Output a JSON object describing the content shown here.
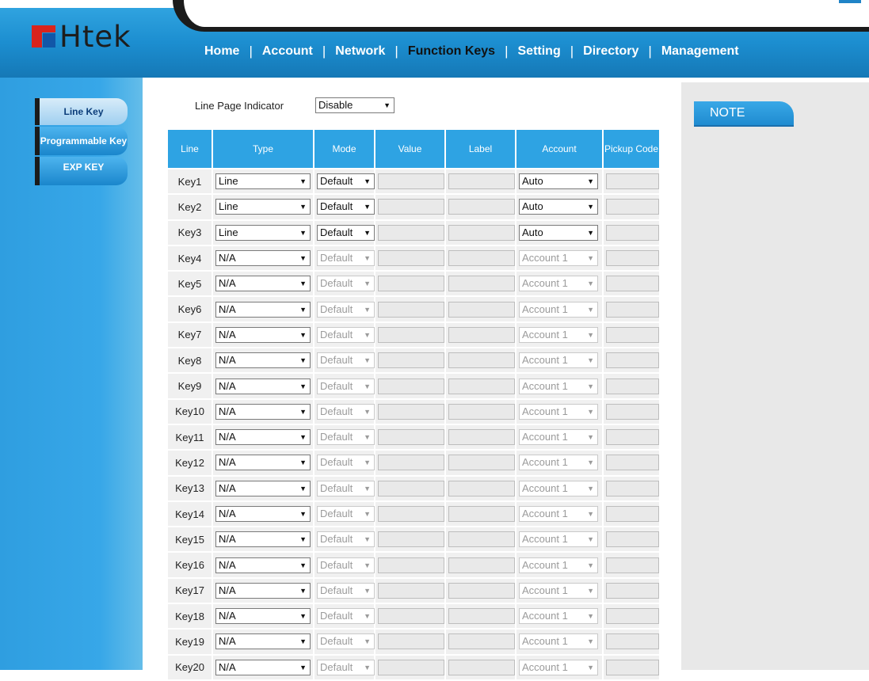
{
  "header": {
    "logo_text": "Htek",
    "nav": [
      {
        "label": "Home",
        "active": false
      },
      {
        "label": "Account",
        "active": false
      },
      {
        "label": "Network",
        "active": false
      },
      {
        "label": "Function Keys",
        "active": true
      },
      {
        "label": "Setting",
        "active": false
      },
      {
        "label": "Directory",
        "active": false
      },
      {
        "label": "Management",
        "active": false
      }
    ],
    "separator": "|"
  },
  "sidebar": {
    "items": [
      {
        "label": "Line Key",
        "active": true
      },
      {
        "label": "Programmable Key",
        "active": false
      },
      {
        "label": "EXP KEY",
        "active": false
      }
    ]
  },
  "main": {
    "line_page_indicator": {
      "label": "Line Page Indicator",
      "value": "Disable"
    },
    "columns": [
      "Line",
      "Type",
      "Mode",
      "Value",
      "Label",
      "Account",
      "Pickup Code"
    ],
    "rows": [
      {
        "line": "Key1",
        "type": "Line",
        "mode": "Default",
        "account": "Auto",
        "enabled": true
      },
      {
        "line": "Key2",
        "type": "Line",
        "mode": "Default",
        "account": "Auto",
        "enabled": true
      },
      {
        "line": "Key3",
        "type": "Line",
        "mode": "Default",
        "account": "Auto",
        "enabled": true
      },
      {
        "line": "Key4",
        "type": "N/A",
        "mode": "Default",
        "account": "Account 1",
        "enabled": false
      },
      {
        "line": "Key5",
        "type": "N/A",
        "mode": "Default",
        "account": "Account 1",
        "enabled": false
      },
      {
        "line": "Key6",
        "type": "N/A",
        "mode": "Default",
        "account": "Account 1",
        "enabled": false
      },
      {
        "line": "Key7",
        "type": "N/A",
        "mode": "Default",
        "account": "Account 1",
        "enabled": false
      },
      {
        "line": "Key8",
        "type": "N/A",
        "mode": "Default",
        "account": "Account 1",
        "enabled": false
      },
      {
        "line": "Key9",
        "type": "N/A",
        "mode": "Default",
        "account": "Account 1",
        "enabled": false
      },
      {
        "line": "Key10",
        "type": "N/A",
        "mode": "Default",
        "account": "Account 1",
        "enabled": false
      },
      {
        "line": "Key11",
        "type": "N/A",
        "mode": "Default",
        "account": "Account 1",
        "enabled": false
      },
      {
        "line": "Key12",
        "type": "N/A",
        "mode": "Default",
        "account": "Account 1",
        "enabled": false
      },
      {
        "line": "Key13",
        "type": "N/A",
        "mode": "Default",
        "account": "Account 1",
        "enabled": false
      },
      {
        "line": "Key14",
        "type": "N/A",
        "mode": "Default",
        "account": "Account 1",
        "enabled": false
      },
      {
        "line": "Key15",
        "type": "N/A",
        "mode": "Default",
        "account": "Account 1",
        "enabled": false
      },
      {
        "line": "Key16",
        "type": "N/A",
        "mode": "Default",
        "account": "Account 1",
        "enabled": false
      },
      {
        "line": "Key17",
        "type": "N/A",
        "mode": "Default",
        "account": "Account 1",
        "enabled": false
      },
      {
        "line": "Key18",
        "type": "N/A",
        "mode": "Default",
        "account": "Account 1",
        "enabled": false
      },
      {
        "line": "Key19",
        "type": "N/A",
        "mode": "Default",
        "account": "Account 1",
        "enabled": false
      },
      {
        "line": "Key20",
        "type": "N/A",
        "mode": "Default",
        "account": "Account 1",
        "enabled": false
      }
    ]
  },
  "note": {
    "title": "NOTE"
  },
  "icons": {
    "dropdown": "chevron-down-icon"
  },
  "colors": {
    "accent": "#2ea3e3",
    "active_nav": "#111111",
    "logo_red": "#d9241c",
    "logo_blue": "#1257a8"
  }
}
